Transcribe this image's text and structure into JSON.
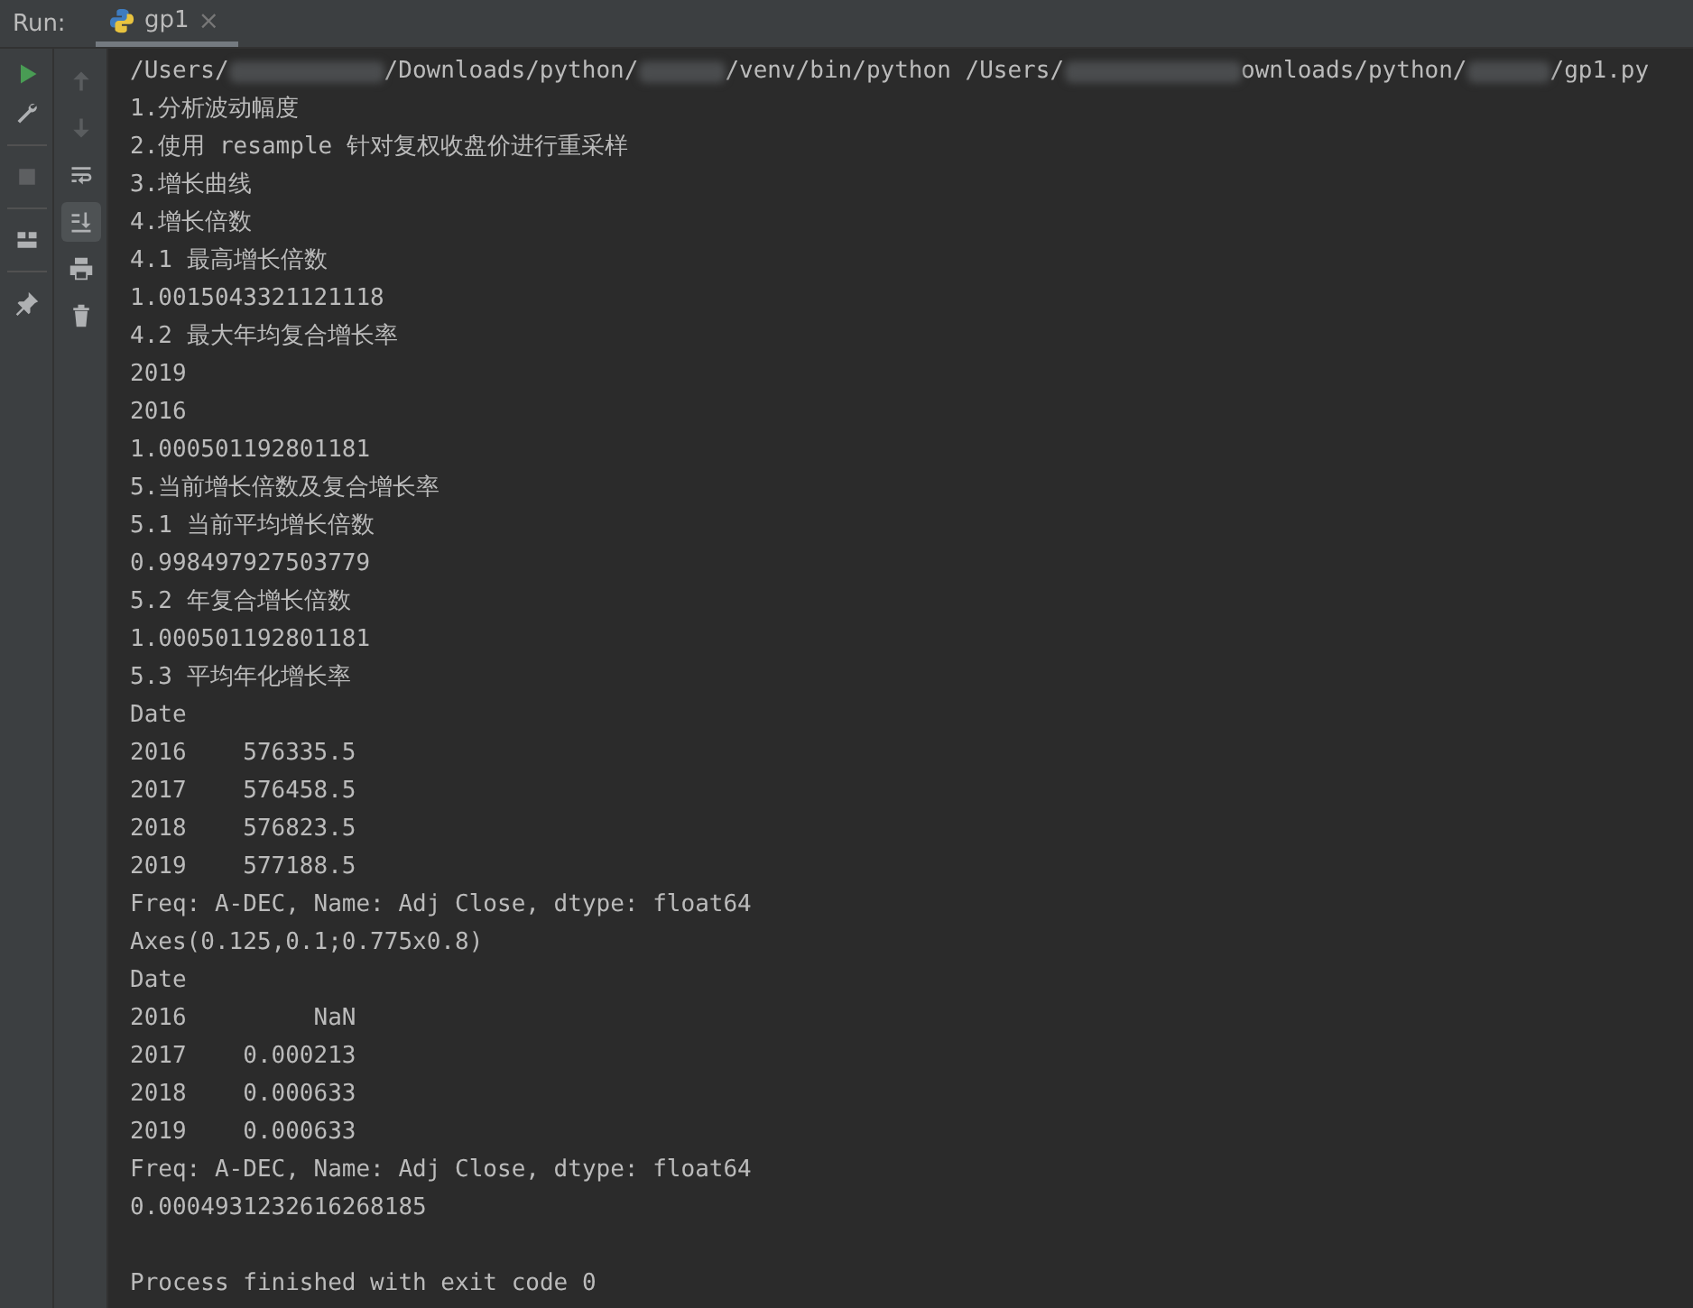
{
  "run_panel": {
    "label": "Run:",
    "tabs": [
      {
        "label": "gp1",
        "close": "×",
        "selected": true
      }
    ]
  },
  "left_toolbar": [
    {
      "kind": "run",
      "disabled": false
    },
    {
      "kind": "wrench",
      "disabled": false
    },
    {
      "kind": "stop",
      "disabled": true
    },
    {
      "kind": "layout",
      "disabled": false
    },
    {
      "kind": "pin",
      "disabled": false
    }
  ],
  "console_toolbar": [
    {
      "kind": "up",
      "disabled": true,
      "on": false
    },
    {
      "kind": "down",
      "disabled": true,
      "on": false
    },
    {
      "kind": "wrap",
      "disabled": false,
      "on": false
    },
    {
      "kind": "scroll-end",
      "disabled": false,
      "on": true
    },
    {
      "kind": "print",
      "disabled": false,
      "on": false
    },
    {
      "kind": "trash",
      "disabled": false,
      "on": false
    }
  ],
  "command_line": [
    {
      "kind": "text",
      "text": "/Users/"
    },
    {
      "kind": "redacted"
    },
    {
      "kind": "text",
      "text": "/Downloads/python/"
    },
    {
      "kind": "redacted"
    },
    {
      "kind": "text",
      "text": "/venv/bin/python /Users/"
    },
    {
      "kind": "redacted"
    },
    {
      "kind": "text",
      "text": "ownloads/python/"
    },
    {
      "kind": "redacted"
    },
    {
      "kind": "text",
      "text": "/gp1.py"
    }
  ],
  "output": [
    "1.分析波动幅度",
    "2.使用 resample 针对复权收盘价进行重采样",
    "3.增长曲线",
    "4.增长倍数",
    "4.1 最高增长倍数",
    "1.0015043321121118",
    "4.2 最大年均复合增长率",
    "2019",
    "2016",
    "1.000501192801181",
    "5.当前增长倍数及复合增长率",
    "5.1 当前平均增长倍数",
    "0.998497927503779",
    "5.2 年复合增长倍数",
    "1.000501192801181",
    "5.3 平均年化增长率",
    "Date",
    "2016    576335.5",
    "2017    576458.5",
    "2018    576823.5",
    "2019    577188.5",
    "Freq: A-DEC, Name: Adj Close, dtype: float64",
    "Axes(0.125,0.1;0.775x0.8)",
    "Date",
    "2016         NaN",
    "2017    0.000213",
    "2018    0.000633",
    "2019    0.000633",
    "Freq: A-DEC, Name: Adj Close, dtype: float64",
    "0.0004931232616268185"
  ],
  "exit_message": "Process finished with exit code 0"
}
